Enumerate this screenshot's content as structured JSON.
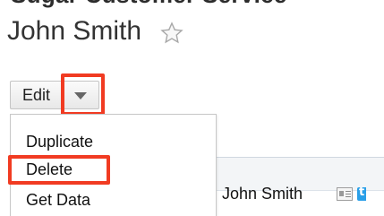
{
  "page": {
    "top_clipped_text": "Sugar Customer Service",
    "record_title": "John Smith",
    "favorite_icon": "star-icon"
  },
  "toolbar": {
    "edit_label": "Edit",
    "dropdown_icon": "caret-down-icon"
  },
  "menu": {
    "items": [
      {
        "label": "Duplicate"
      },
      {
        "label": "Delete"
      },
      {
        "label": "Get Data"
      }
    ]
  },
  "table": {
    "rows": [
      {
        "name": "John Smith",
        "icons": [
          "vcard-icon",
          "twitter-icon"
        ]
      }
    ]
  },
  "highlight": {
    "color": "#f13b22"
  }
}
